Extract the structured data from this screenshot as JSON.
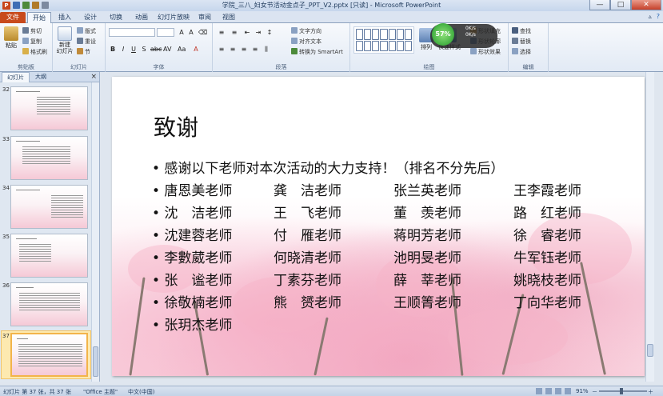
{
  "window": {
    "title": "学院_三八_妇女节活动金点子_PPT_V2.pptx [只读] - Microsoft PowerPoint",
    "app_icon": "P",
    "minimize": "—",
    "maximize": "□",
    "close": "✕"
  },
  "tabs": [
    {
      "label": "文件"
    },
    {
      "label": "开始"
    },
    {
      "label": "插入"
    },
    {
      "label": "设计"
    },
    {
      "label": "切换"
    },
    {
      "label": "动画"
    },
    {
      "label": "幻灯片放映"
    },
    {
      "label": "审阅"
    },
    {
      "label": "视图"
    }
  ],
  "ribbon": {
    "clipboard": {
      "paste": "粘贴",
      "cut": "剪切",
      "copy": "复制",
      "format_painter": "格式刷",
      "label": "剪贴板"
    },
    "slides": {
      "new_slide": "新建\n幻灯片",
      "layout": "版式",
      "reset": "重设",
      "section": "节",
      "label": "幻灯片"
    },
    "font": {
      "label": "字体"
    },
    "paragraph": {
      "text_direction": "文字方向",
      "align_text": "对齐文本",
      "smartart": "转换为 SmartArt",
      "label": "段落"
    },
    "drawing": {
      "arrange": "排列",
      "quick_styles": "快速样式",
      "shape_fill": "形状填充",
      "shape_outline": "形状轮廓",
      "shape_effects": "形状效果",
      "label": "绘图"
    },
    "editing": {
      "find": "查找",
      "replace": "替换",
      "select": "选择",
      "label": "编辑"
    },
    "overlay": {
      "percent": "57%",
      "up": "0K/s",
      "down": "0K/s"
    }
  },
  "left_pane": {
    "tab_slides": "幻灯片",
    "tab_outline": "大纲",
    "close": "×",
    "thumbnails": [
      {
        "num": "32",
        "title": "活动目标 · 公司"
      },
      {
        "num": "33",
        "title": "活动目标 · 公司"
      },
      {
        "num": "34",
        "title": "活动目标 · 公司"
      },
      {
        "num": "35",
        "title": "活动分配表"
      },
      {
        "num": "36",
        "title": "活动总结"
      },
      {
        "num": "37",
        "title": "致谢"
      }
    ]
  },
  "slide": {
    "title": "致谢",
    "intro": "• 感谢以下老师对本次活动的大力支持！（排名不分先后）",
    "rows": [
      [
        "• 唐恩美老师",
        "龚　洁老师",
        "张兰英老师",
        "王李霞老师"
      ],
      [
        "• 沈　洁老师",
        "王　飞老师",
        "董　羡老师",
        "路　红老师"
      ],
      [
        "• 沈建蓉老师",
        "付　雁老师",
        "蒋明芳老师",
        "徐　睿老师"
      ],
      [
        "• 李數葳老师",
        "何晓清老师",
        "池明旻老师",
        "牛军钰老师"
      ],
      [
        "• 张　谧老师",
        "丁素芬老师",
        "薛　莘老师",
        "姚晓枝老师"
      ],
      [
        "• 徐敬楠老师",
        "熊　赟老师",
        "王顺箐老师",
        "丁向华老师"
      ],
      [
        "• 张玥杰老师",
        "",
        "",
        ""
      ]
    ]
  },
  "status": {
    "slide_info": "幻灯片 第 37 张，共 37 张",
    "theme": "\"Office 主题\"",
    "language": "中文(中国)",
    "zoom": "91%",
    "zoom_minus": "－",
    "zoom_plus": "＋"
  },
  "colors": {
    "file_tab": "#c84a1c",
    "accent": "#1e395b",
    "selected_thumb": "#f2b44a",
    "blossom": "#f5aac3"
  }
}
